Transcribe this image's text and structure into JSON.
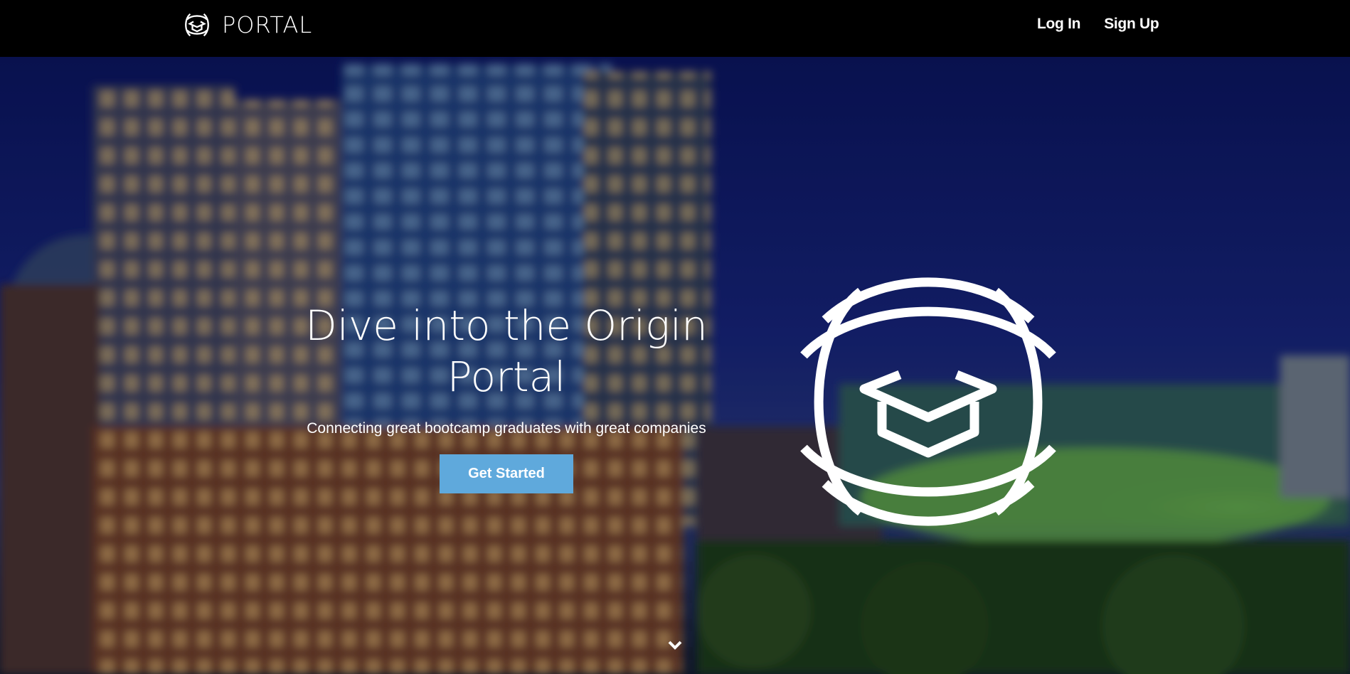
{
  "navbar": {
    "brand": "PORTAL",
    "brand_icon": "portal-logo-icon",
    "links": [
      {
        "label": "Log In"
      },
      {
        "label": "Sign Up"
      }
    ]
  },
  "hero": {
    "title": "Dive into the Origin Portal",
    "subtitle": "Connecting great bootcamp graduates with great companies",
    "cta_label": "Get Started",
    "logo_icon": "orbit-graduation-cap-icon",
    "scroll_icon": "chevron-down-icon",
    "background": "night-city-skyline-photo"
  },
  "colors": {
    "navbar_bg": "#000000",
    "cta_bg": "#5fa9dc",
    "text": "#ffffff"
  }
}
